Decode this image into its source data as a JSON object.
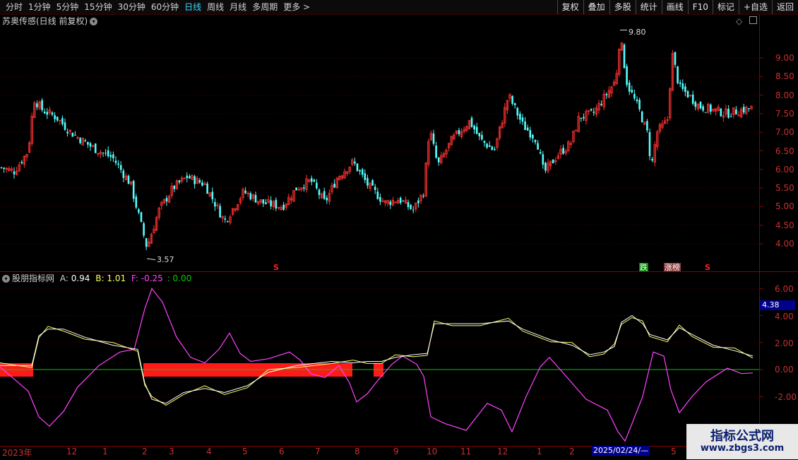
{
  "toolbar": {
    "periods": [
      "分时",
      "1分钟",
      "5分钟",
      "15分钟",
      "30分钟",
      "60分钟",
      "日线",
      "周线",
      "月线",
      "多周期",
      "更多 >"
    ],
    "active_period": "日线",
    "right_buttons": [
      "复权",
      "叠加",
      "多股",
      "统计",
      "画线",
      "F10",
      "标记",
      "+自选",
      "返回"
    ]
  },
  "price_panel": {
    "title": "苏奥传感(日线 前复权)",
    "high_label": "9.80",
    "low_label": "3.57",
    "y_ticks": [
      "9.00",
      "8.50",
      "8.00",
      "7.50",
      "7.00",
      "6.50",
      "6.00",
      "5.50",
      "5.00",
      "4.50",
      "4.00"
    ],
    "signals": [
      {
        "text": "S",
        "color": "#ff2020"
      },
      {
        "text": "跌",
        "color": "#ffffff",
        "bg": "#0a8a0a"
      },
      {
        "text": "涨榜",
        "color": "#ffffff",
        "bg": "#8a3a3a"
      },
      {
        "text": "S",
        "color": "#ff2020"
      }
    ]
  },
  "indicator_panel": {
    "name": "股朋指标网",
    "a_label": "A:",
    "a_value": "0.94",
    "b_label": "B:",
    "b_value": "1.01",
    "f_label": "F:",
    "f_value": "-0.25",
    "zero_label": ": 0.00",
    "y_ticks": [
      "6.00",
      "4.00",
      "2.00",
      "0.00",
      "-2.00"
    ],
    "current_value": "4.38"
  },
  "x_axis": {
    "labels": [
      "2023年",
      "12",
      "1",
      "2",
      "3",
      "4",
      "5",
      "6",
      "7",
      "8",
      "9",
      "10",
      "11",
      "12",
      "1",
      "2",
      "5"
    ],
    "cursor_date": "2025/02/24/—"
  },
  "watermark": {
    "title": "指标公式网",
    "url": "www.zbgs3.com"
  },
  "colors": {
    "up": "#ff3232",
    "down": "#54ffff",
    "line_a": "#ffffff",
    "line_b": "#ffff66",
    "line_f": "#ff44ff",
    "zero_line": "#00cc00",
    "bar_block": "#ff1a1a"
  }
}
